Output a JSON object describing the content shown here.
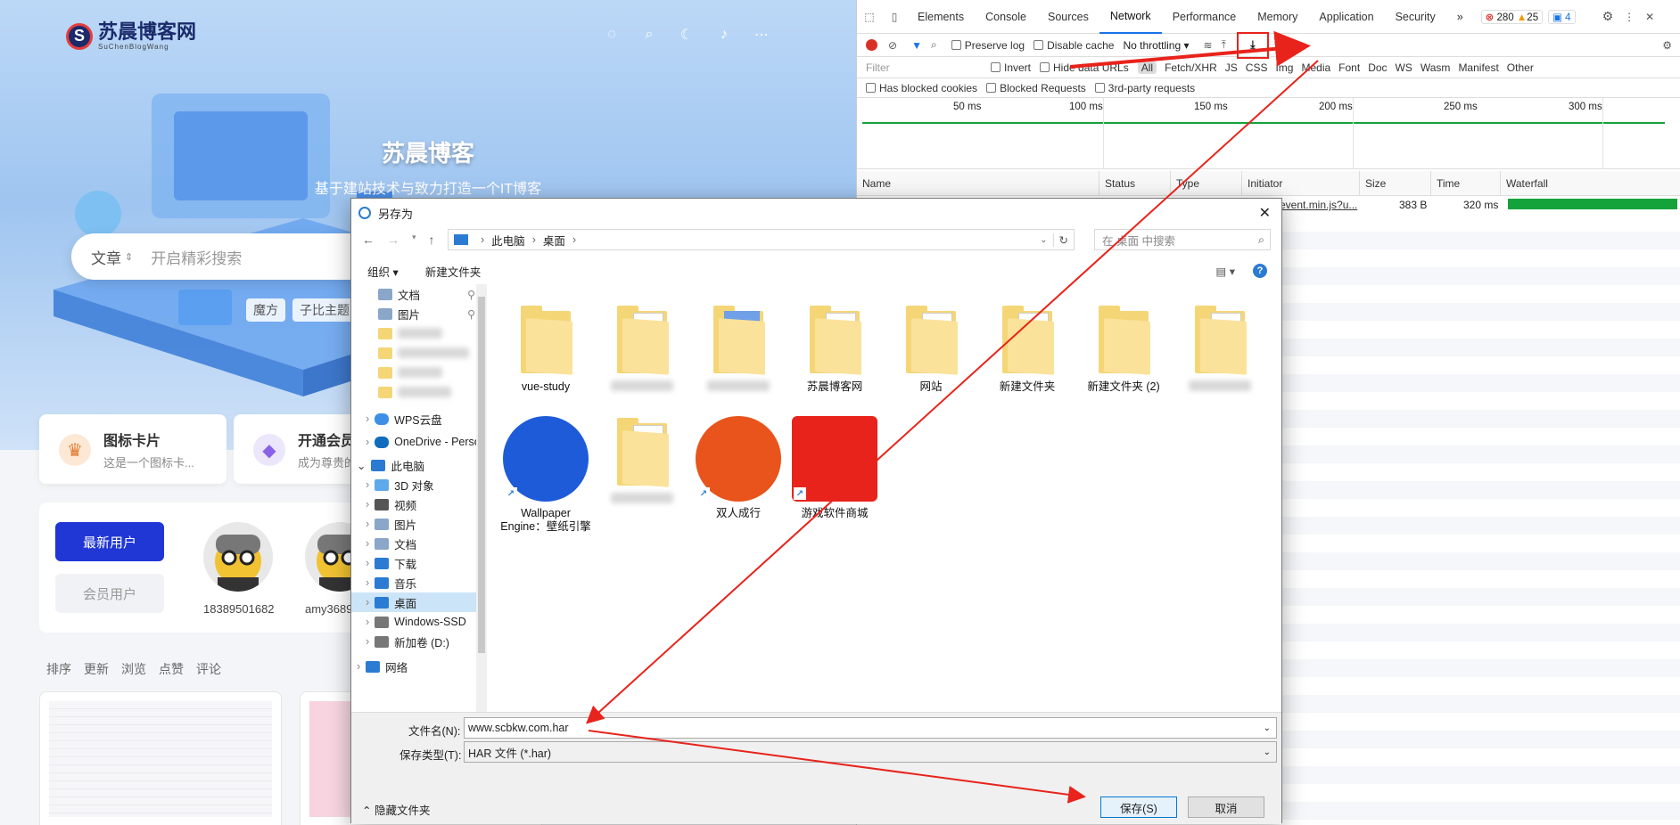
{
  "site": {
    "logo_text": "苏晨博客网",
    "logo_sub": "SuChenBlogWang",
    "hero_title": "苏晨博客",
    "hero_subtitle": "基于建站技术与致力打造一个IT博客",
    "search_category": "文章",
    "search_placeholder": "开启精彩搜索",
    "tags": [
      "魔方",
      "子比主题"
    ],
    "cards": [
      {
        "title": "图标卡片",
        "desc": "这是一个图标卡..."
      },
      {
        "title": "开通会员",
        "desc": "成为尊贵的"
      }
    ],
    "btn_new_users": "最新用户",
    "btn_members": "会员用户",
    "users": [
      "18389501682",
      "amy3689"
    ],
    "sort_label": "排序",
    "sort_items": [
      "更新",
      "浏览",
      "点赞",
      "评论"
    ]
  },
  "devtools": {
    "tabs": [
      "Elements",
      "Console",
      "Sources",
      "Network",
      "Performance",
      "Memory",
      "Application",
      "Security"
    ],
    "active_tab": "Network",
    "more_tabs": "»",
    "errors": "280",
    "warnings": "25",
    "messages": "4",
    "preserve_log": "Preserve log",
    "disable_cache": "Disable cache",
    "throttling": "No throttling",
    "filter_placeholder": "Filter",
    "invert": "Invert",
    "hide_data_urls": "Hide data URLs",
    "types": [
      "All",
      "Fetch/XHR",
      "JS",
      "CSS",
      "Img",
      "Media",
      "Font",
      "Doc",
      "WS",
      "Wasm",
      "Manifest",
      "Other"
    ],
    "has_blocked_cookies": "Has blocked cookies",
    "blocked_requests": "Blocked Requests",
    "third_party": "3rd-party requests",
    "timeline_ticks": [
      "50 ms",
      "100 ms",
      "150 ms",
      "200 ms",
      "250 ms",
      "300 ms"
    ],
    "columns": [
      "Name",
      "Status",
      "Type",
      "Initiator",
      "Size",
      "Time",
      "Waterfall"
    ],
    "row": {
      "initiator": "event.min.js?u...",
      "size": "383 B",
      "time": "320 ms"
    }
  },
  "dialog": {
    "title": "另存为",
    "path": [
      "此电脑",
      "桌面"
    ],
    "search_placeholder": "在 桌面 中搜索",
    "organize": "组织 ▾",
    "new_folder": "新建文件夹",
    "nav": {
      "quick": [
        "文档",
        "图片"
      ],
      "wps": "WPS云盘",
      "onedrive": "OneDrive - Perso",
      "pc": "此电脑",
      "pc_items": [
        "3D 对象",
        "视频",
        "图片",
        "文档",
        "下载",
        "音乐",
        "桌面",
        "Windows-SSD",
        "新加卷 (D:)"
      ],
      "network": "网络"
    },
    "files": [
      {
        "name": "vue-study",
        "kind": "folder"
      },
      {
        "name": "",
        "kind": "folder-doc"
      },
      {
        "name": "",
        "kind": "folder-blue"
      },
      {
        "name": "苏晨博客网",
        "kind": "folder-doc"
      },
      {
        "name": "网站",
        "kind": "folder-doc"
      },
      {
        "name": "新建文件夹",
        "kind": "folder-doc"
      },
      {
        "name": "新建文件夹 (2)",
        "kind": "folder"
      },
      {
        "name": "",
        "kind": "folder-doc"
      },
      {
        "name": "Wallpaper Engine：壁纸引擎",
        "kind": "app"
      },
      {
        "name": "",
        "kind": "folder-doc"
      },
      {
        "name": "双人成行",
        "kind": "app"
      },
      {
        "name": "游戏软件商城",
        "kind": "app"
      }
    ],
    "filename_label": "文件名(N):",
    "filename_value": "www.scbkw.com.har",
    "filetype_label": "保存类型(T):",
    "filetype_value": "HAR 文件 (*.har)",
    "hide_folders": "隐藏文件夹",
    "save": "保存(S)",
    "cancel": "取消"
  },
  "colors": {
    "accent_red": "#e8231b",
    "devtools_blue": "#1a73e8",
    "waterfall_green": "#14a33a",
    "brand_blue": "#2037d6"
  }
}
